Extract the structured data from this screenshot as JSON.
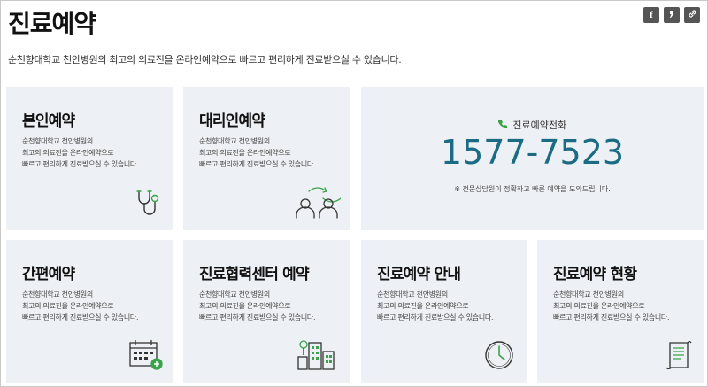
{
  "page": {
    "title": "진료예약",
    "subtitle": "순천향대학교 천안병원의 최고의 의료진을 온라인예약으로 빠르고 편리하게 진료받으실 수 있습니다."
  },
  "share": {
    "facebook": "f",
    "kakao": "❜",
    "link": "🔗"
  },
  "cards": [
    {
      "title": "본인예약",
      "desc": [
        "순천향대학교 천안병원의",
        "최고의 의료진을 온라인예약으로",
        "빠르고 편리하게 진료받으실 수 있습니다."
      ],
      "icon": "stethoscope-icon"
    },
    {
      "title": "대리인예약",
      "desc": [
        "순천향대학교 천안병원의",
        "최고의 의료진을 온라인예약으로",
        "빠르고 편리하게 진료받으실 수 있습니다."
      ],
      "icon": "proxy-people-icon"
    },
    {
      "title": "간편예약",
      "desc": [
        "순천향대학교 천안병원의",
        "최고의 의료진을 온라인예약으로",
        "빠르고 편리하게 진료받으실 수 있습니다."
      ],
      "icon": "calendar-add-icon"
    },
    {
      "title": "진료협력센터 예약",
      "desc": [
        "순천향대학교 천안병원의",
        "최고의 의료진을 온라인예약으로",
        "빠르고 편리하게 진료받으실 수 있습니다."
      ],
      "icon": "buildings-icon"
    },
    {
      "title": "진료예약 안내",
      "desc": [
        "순천향대학교 천안병원의",
        "최고의 의료진을 온라인예약으로",
        "빠르고 편리하게 진료받으실 수 있습니다."
      ],
      "icon": "clock-icon"
    },
    {
      "title": "진료예약 현황",
      "desc": [
        "순천향대학교 천안병원의",
        "최고의 의료진을 온라인예약으로",
        "빠르고 편리하게 진료받으실 수 있습니다."
      ],
      "icon": "document-icon"
    }
  ],
  "phone": {
    "label": "진료예약전화",
    "number": "1577-7523",
    "note": "※ 전문상담원이 정확하고 빠른 예약을 도와드립니다."
  },
  "colors": {
    "card_bg": "#edf0f4",
    "accent_green": "#3aa34a",
    "phone_blue": "#1b6b84"
  }
}
